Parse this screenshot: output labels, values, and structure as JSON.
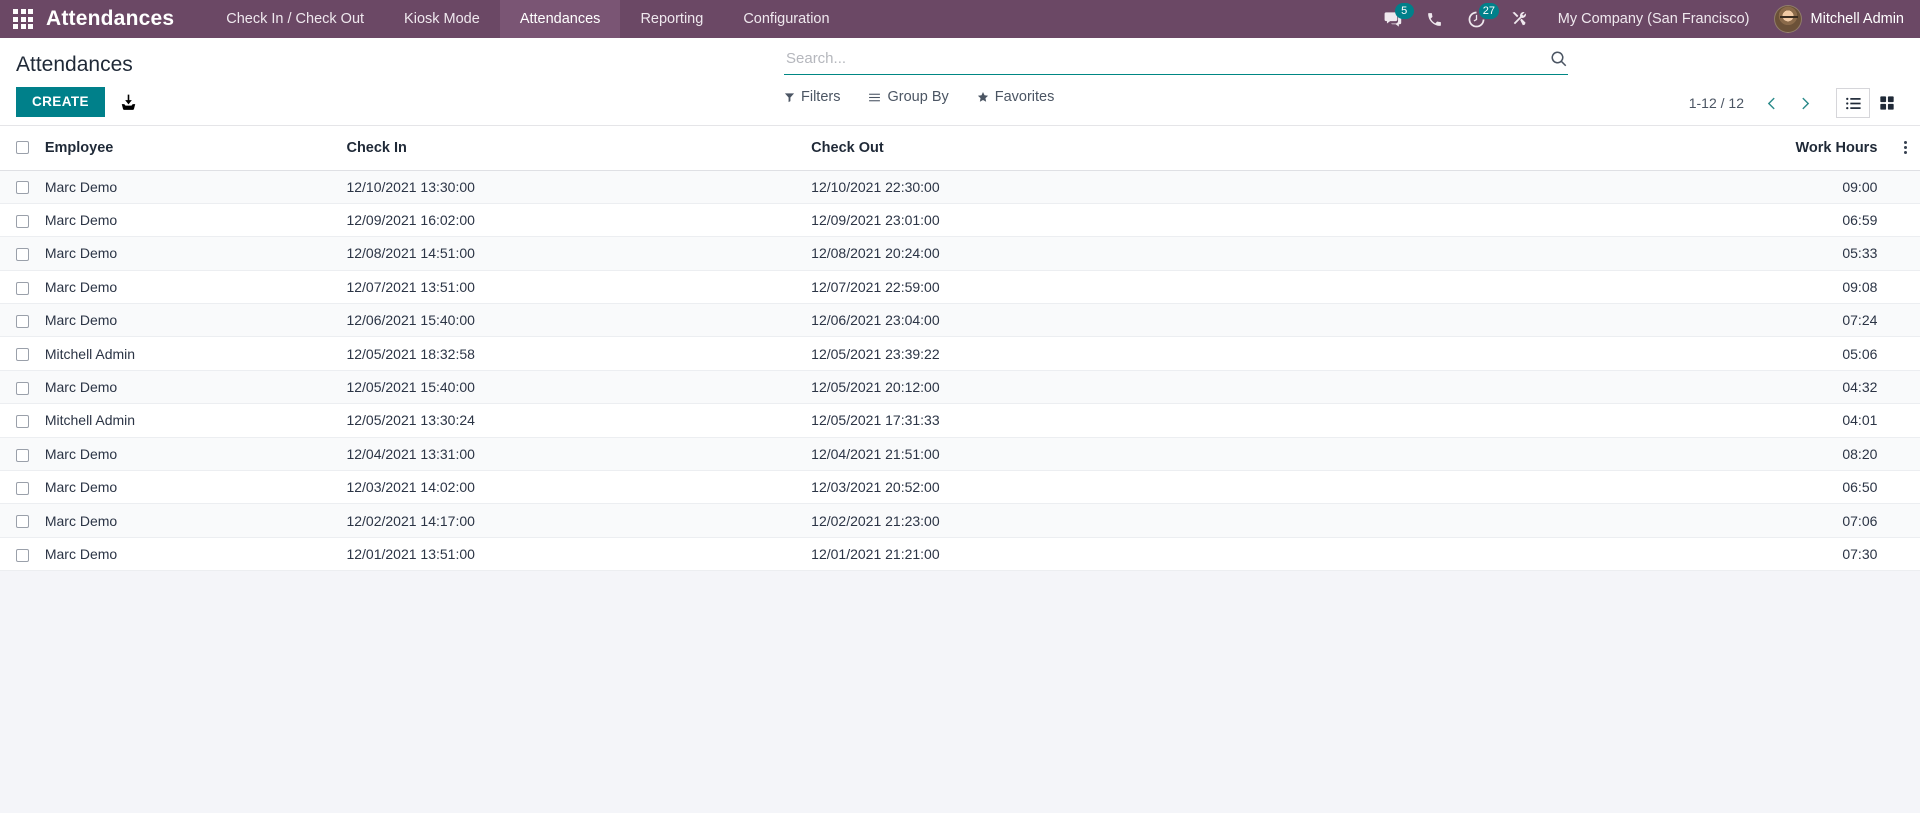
{
  "colors": {
    "navbar": "#6b4865",
    "navbar_active": "#7a5574",
    "accent_teal": "#00808a",
    "badge": "#00808a",
    "page_bg": "#f4f5f9"
  },
  "navbar": {
    "apps_icon": "apps-grid-icon",
    "brand": "Attendances",
    "menu": [
      {
        "label": "Check In / Check Out",
        "active": false
      },
      {
        "label": "Kiosk Mode",
        "active": false
      },
      {
        "label": "Attendances",
        "active": true
      },
      {
        "label": "Reporting",
        "active": false
      },
      {
        "label": "Configuration",
        "active": false
      }
    ],
    "systray": [
      {
        "icon": "messages-icon",
        "badge": "5"
      },
      {
        "icon": "phone-icon",
        "badge": ""
      },
      {
        "icon": "activity-clock-icon",
        "badge": "27"
      },
      {
        "icon": "tools-wrench-icon",
        "badge": ""
      }
    ],
    "company": "My Company (San Francisco)",
    "user": "Mitchell Admin",
    "avatar_icon": "user-avatar"
  },
  "control_panel": {
    "title": "Attendances",
    "create_label": "CREATE",
    "import_icon": "import-download-icon",
    "search": {
      "placeholder": "Search...",
      "value": "",
      "search_icon": "search-icon"
    },
    "facets": [
      {
        "label": "Filters",
        "icon": "filter-funnel-icon"
      },
      {
        "label": "Group By",
        "icon": "group-by-lines-icon"
      },
      {
        "label": "Favorites",
        "icon": "favorites-star-icon"
      }
    ],
    "pager": {
      "range": "1-12 / 12",
      "prev_icon": "chevron-left-icon",
      "next_icon": "chevron-right-icon"
    },
    "views": [
      {
        "icon": "list-view-icon",
        "active": true
      },
      {
        "icon": "kanban-view-icon",
        "active": false
      }
    ]
  },
  "table": {
    "select_all_icon": "checkbox",
    "options_icon": "vertical-dots-icon",
    "columns": [
      "Employee",
      "Check In",
      "Check Out",
      "Work Hours"
    ],
    "rows": [
      {
        "employee": "Marc Demo",
        "check_in": "12/10/2021 13:30:00",
        "check_out": "12/10/2021 22:30:00",
        "work_hours": "09:00"
      },
      {
        "employee": "Marc Demo",
        "check_in": "12/09/2021 16:02:00",
        "check_out": "12/09/2021 23:01:00",
        "work_hours": "06:59"
      },
      {
        "employee": "Marc Demo",
        "check_in": "12/08/2021 14:51:00",
        "check_out": "12/08/2021 20:24:00",
        "work_hours": "05:33"
      },
      {
        "employee": "Marc Demo",
        "check_in": "12/07/2021 13:51:00",
        "check_out": "12/07/2021 22:59:00",
        "work_hours": "09:08"
      },
      {
        "employee": "Marc Demo",
        "check_in": "12/06/2021 15:40:00",
        "check_out": "12/06/2021 23:04:00",
        "work_hours": "07:24"
      },
      {
        "employee": "Mitchell Admin",
        "check_in": "12/05/2021 18:32:58",
        "check_out": "12/05/2021 23:39:22",
        "work_hours": "05:06"
      },
      {
        "employee": "Marc Demo",
        "check_in": "12/05/2021 15:40:00",
        "check_out": "12/05/2021 20:12:00",
        "work_hours": "04:32"
      },
      {
        "employee": "Mitchell Admin",
        "check_in": "12/05/2021 13:30:24",
        "check_out": "12/05/2021 17:31:33",
        "work_hours": "04:01"
      },
      {
        "employee": "Marc Demo",
        "check_in": "12/04/2021 13:31:00",
        "check_out": "12/04/2021 21:51:00",
        "work_hours": "08:20"
      },
      {
        "employee": "Marc Demo",
        "check_in": "12/03/2021 14:02:00",
        "check_out": "12/03/2021 20:52:00",
        "work_hours": "06:50"
      },
      {
        "employee": "Marc Demo",
        "check_in": "12/02/2021 14:17:00",
        "check_out": "12/02/2021 21:23:00",
        "work_hours": "07:06"
      },
      {
        "employee": "Marc Demo",
        "check_in": "12/01/2021 13:51:00",
        "check_out": "12/01/2021 21:21:00",
        "work_hours": "07:30"
      }
    ]
  }
}
